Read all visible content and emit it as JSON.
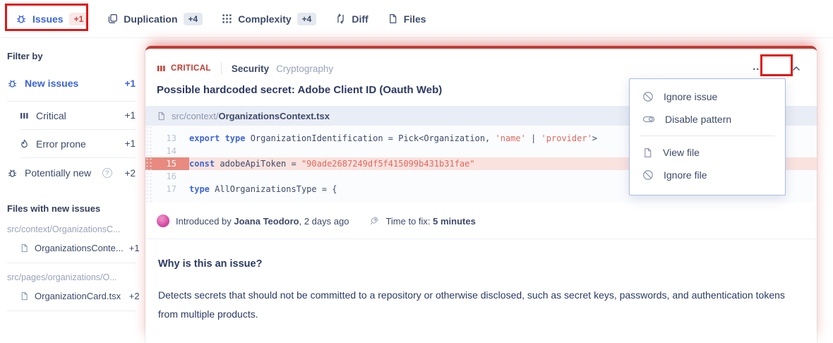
{
  "colors": {
    "accent_blue": "#3a63d8",
    "severity_red": "#c3392f",
    "annotation_red": "#e01717",
    "highlight_line_bg": "#fae2de",
    "highlight_gutter_bg": "#e88a7f",
    "filebar_bg": "#e9edf5",
    "avatar_pink": "#cf3f9d"
  },
  "tabs": [
    {
      "label": "Issues",
      "badge": "+1",
      "icon": "bug-icon",
      "active": true
    },
    {
      "label": "Duplication",
      "badge": "+4",
      "icon": "duplication-icon"
    },
    {
      "label": "Complexity",
      "badge": "+4",
      "icon": "complexity-icon"
    },
    {
      "label": "Diff",
      "icon": "diff-icon"
    },
    {
      "label": "Files",
      "icon": "files-icon"
    }
  ],
  "sidebar": {
    "filter_heading": "Filter by",
    "filters": [
      {
        "label": "New issues",
        "count": "+1",
        "icon": "bug-icon",
        "active": true
      },
      {
        "label": "Critical",
        "count": "+1",
        "icon": "severity-bars-icon"
      },
      {
        "label": "Error prone",
        "count": "+1",
        "icon": "flame-icon"
      },
      {
        "label": "Potentially new",
        "count": "+2",
        "icon": "bug-icon",
        "help_icon": "question-circle-icon"
      }
    ],
    "files_heading": "Files with new issues",
    "file_groups": [
      {
        "path": "src/context/OrganizationsC...",
        "file": "OrganizationsConte...",
        "count": "+1"
      },
      {
        "path": "src/pages/organizations/O...",
        "file": "OrganizationCard.tsx",
        "count": " +2"
      }
    ]
  },
  "issue": {
    "severity": "CRITICAL",
    "category": "Security",
    "subcategory": "Cryptography",
    "title": "Possible hardcoded secret: Adobe Client ID (Oauth Web)",
    "path_prefix": "src/context/",
    "file_name": "OrganizationsContext.tsx",
    "code_lines": [
      {
        "number": "13",
        "tokens": [
          {
            "t": "kw",
            "v": "export type"
          },
          {
            "t": "pl",
            "v": " OrganizationIdentification = Pick<Organization, "
          },
          {
            "t": "str",
            "v": "'name'"
          },
          {
            "t": "pl",
            "v": " | "
          },
          {
            "t": "str",
            "v": "'provider'"
          },
          {
            "t": "pl",
            "v": ">"
          }
        ]
      },
      {
        "number": "14",
        "tokens": []
      },
      {
        "number": "15",
        "highlight": true,
        "tokens": [
          {
            "t": "kw",
            "v": "const"
          },
          {
            "t": "pl",
            "v": " adobeApiToken = "
          },
          {
            "t": "str",
            "v": "\"90ade2687249df5f415099b431b31fae\""
          }
        ]
      },
      {
        "number": "16",
        "tokens": []
      },
      {
        "number": "17",
        "tokens": [
          {
            "t": "kw",
            "v": "type"
          },
          {
            "t": "pl",
            "v": " AllOrganizationsType = {"
          }
        ]
      }
    ],
    "meta": {
      "prefix": "Introduced by ",
      "author": "Joana Teodoro",
      "suffix": ", 2 days ago",
      "ttf_label": "Time to fix: ",
      "ttf_value": "5 minutes"
    },
    "why_heading": "Why is this an issue?",
    "why_text": "Detects secrets that should not be committed to a repository or otherwise disclosed, such as secret keys, passwords, and authentication tokens from multiple products."
  },
  "menu": {
    "trigger_label": "...",
    "items": [
      {
        "label": "Ignore issue",
        "icon": "ban-icon"
      },
      {
        "label": "Disable pattern",
        "icon": "toggle-icon"
      },
      {
        "label": "View file",
        "icon": "file-icon"
      },
      {
        "label": "Ignore file",
        "icon": "ban-icon"
      }
    ]
  }
}
